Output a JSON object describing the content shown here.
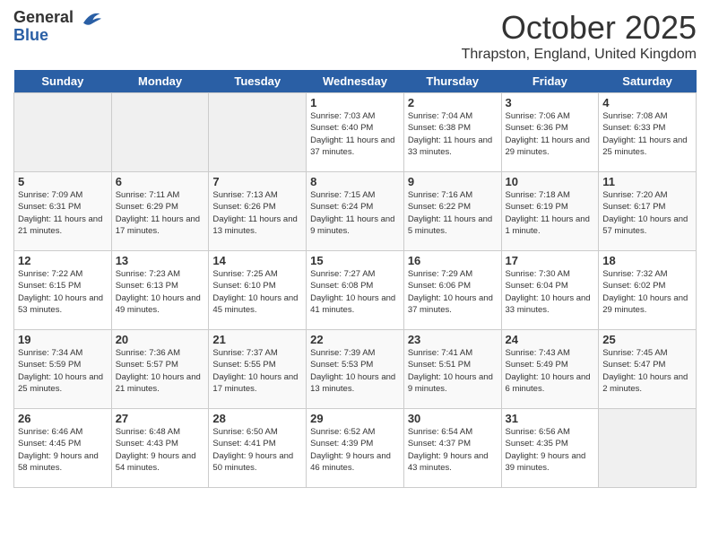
{
  "header": {
    "logo": {
      "line1": "General",
      "line2": "Blue"
    },
    "title": "October 2025",
    "location": "Thrapston, England, United Kingdom"
  },
  "days_of_week": [
    "Sunday",
    "Monday",
    "Tuesday",
    "Wednesday",
    "Thursday",
    "Friday",
    "Saturday"
  ],
  "weeks": [
    [
      {
        "day": "",
        "info": ""
      },
      {
        "day": "",
        "info": ""
      },
      {
        "day": "",
        "info": ""
      },
      {
        "day": "1",
        "info": "Sunrise: 7:03 AM\nSunset: 6:40 PM\nDaylight: 11 hours and 37 minutes."
      },
      {
        "day": "2",
        "info": "Sunrise: 7:04 AM\nSunset: 6:38 PM\nDaylight: 11 hours and 33 minutes."
      },
      {
        "day": "3",
        "info": "Sunrise: 7:06 AM\nSunset: 6:36 PM\nDaylight: 11 hours and 29 minutes."
      },
      {
        "day": "4",
        "info": "Sunrise: 7:08 AM\nSunset: 6:33 PM\nDaylight: 11 hours and 25 minutes."
      }
    ],
    [
      {
        "day": "5",
        "info": "Sunrise: 7:09 AM\nSunset: 6:31 PM\nDaylight: 11 hours and 21 minutes."
      },
      {
        "day": "6",
        "info": "Sunrise: 7:11 AM\nSunset: 6:29 PM\nDaylight: 11 hours and 17 minutes."
      },
      {
        "day": "7",
        "info": "Sunrise: 7:13 AM\nSunset: 6:26 PM\nDaylight: 11 hours and 13 minutes."
      },
      {
        "day": "8",
        "info": "Sunrise: 7:15 AM\nSunset: 6:24 PM\nDaylight: 11 hours and 9 minutes."
      },
      {
        "day": "9",
        "info": "Sunrise: 7:16 AM\nSunset: 6:22 PM\nDaylight: 11 hours and 5 minutes."
      },
      {
        "day": "10",
        "info": "Sunrise: 7:18 AM\nSunset: 6:19 PM\nDaylight: 11 hours and 1 minute."
      },
      {
        "day": "11",
        "info": "Sunrise: 7:20 AM\nSunset: 6:17 PM\nDaylight: 10 hours and 57 minutes."
      }
    ],
    [
      {
        "day": "12",
        "info": "Sunrise: 7:22 AM\nSunset: 6:15 PM\nDaylight: 10 hours and 53 minutes."
      },
      {
        "day": "13",
        "info": "Sunrise: 7:23 AM\nSunset: 6:13 PM\nDaylight: 10 hours and 49 minutes."
      },
      {
        "day": "14",
        "info": "Sunrise: 7:25 AM\nSunset: 6:10 PM\nDaylight: 10 hours and 45 minutes."
      },
      {
        "day": "15",
        "info": "Sunrise: 7:27 AM\nSunset: 6:08 PM\nDaylight: 10 hours and 41 minutes."
      },
      {
        "day": "16",
        "info": "Sunrise: 7:29 AM\nSunset: 6:06 PM\nDaylight: 10 hours and 37 minutes."
      },
      {
        "day": "17",
        "info": "Sunrise: 7:30 AM\nSunset: 6:04 PM\nDaylight: 10 hours and 33 minutes."
      },
      {
        "day": "18",
        "info": "Sunrise: 7:32 AM\nSunset: 6:02 PM\nDaylight: 10 hours and 29 minutes."
      }
    ],
    [
      {
        "day": "19",
        "info": "Sunrise: 7:34 AM\nSunset: 5:59 PM\nDaylight: 10 hours and 25 minutes."
      },
      {
        "day": "20",
        "info": "Sunrise: 7:36 AM\nSunset: 5:57 PM\nDaylight: 10 hours and 21 minutes."
      },
      {
        "day": "21",
        "info": "Sunrise: 7:37 AM\nSunset: 5:55 PM\nDaylight: 10 hours and 17 minutes."
      },
      {
        "day": "22",
        "info": "Sunrise: 7:39 AM\nSunset: 5:53 PM\nDaylight: 10 hours and 13 minutes."
      },
      {
        "day": "23",
        "info": "Sunrise: 7:41 AM\nSunset: 5:51 PM\nDaylight: 10 hours and 9 minutes."
      },
      {
        "day": "24",
        "info": "Sunrise: 7:43 AM\nSunset: 5:49 PM\nDaylight: 10 hours and 6 minutes."
      },
      {
        "day": "25",
        "info": "Sunrise: 7:45 AM\nSunset: 5:47 PM\nDaylight: 10 hours and 2 minutes."
      }
    ],
    [
      {
        "day": "26",
        "info": "Sunrise: 6:46 AM\nSunset: 4:45 PM\nDaylight: 9 hours and 58 minutes."
      },
      {
        "day": "27",
        "info": "Sunrise: 6:48 AM\nSunset: 4:43 PM\nDaylight: 9 hours and 54 minutes."
      },
      {
        "day": "28",
        "info": "Sunrise: 6:50 AM\nSunset: 4:41 PM\nDaylight: 9 hours and 50 minutes."
      },
      {
        "day": "29",
        "info": "Sunrise: 6:52 AM\nSunset: 4:39 PM\nDaylight: 9 hours and 46 minutes."
      },
      {
        "day": "30",
        "info": "Sunrise: 6:54 AM\nSunset: 4:37 PM\nDaylight: 9 hours and 43 minutes."
      },
      {
        "day": "31",
        "info": "Sunrise: 6:56 AM\nSunset: 4:35 PM\nDaylight: 9 hours and 39 minutes."
      },
      {
        "day": "",
        "info": ""
      }
    ]
  ]
}
